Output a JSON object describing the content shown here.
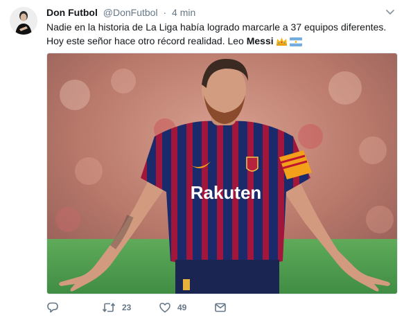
{
  "tweet": {
    "author_name": "Don Futbol",
    "author_handle": "@DonFutbol",
    "separator": "·",
    "timestamp": "4 min",
    "text_line1": "Nadie en la historia de La Liga había logrado marcarle a 37 equipos diferentes.",
    "text_line2_prefix": "Hoy este señor hace otro récord realidad. Leo ",
    "text_bold": "Messi",
    "emojis": [
      "crown-icon",
      "argentina-flag-icon"
    ],
    "image": {
      "description_icon": "player-photo",
      "sponsor_text": "Rakuten",
      "colors": {
        "kit_blue": "#1b2a6b",
        "kit_red": "#a3163b",
        "pitch": "#4f9a4e",
        "crowd": "#c98a78"
      }
    }
  },
  "actions": {
    "reply_icon": "reply-icon",
    "retweet_icon": "retweet-icon",
    "retweet_count": "23",
    "like_icon": "heart-icon",
    "like_count": "49",
    "dm_icon": "envelope-icon"
  },
  "colors": {
    "secondary_text": "#657786",
    "primary_text": "#14171a"
  }
}
